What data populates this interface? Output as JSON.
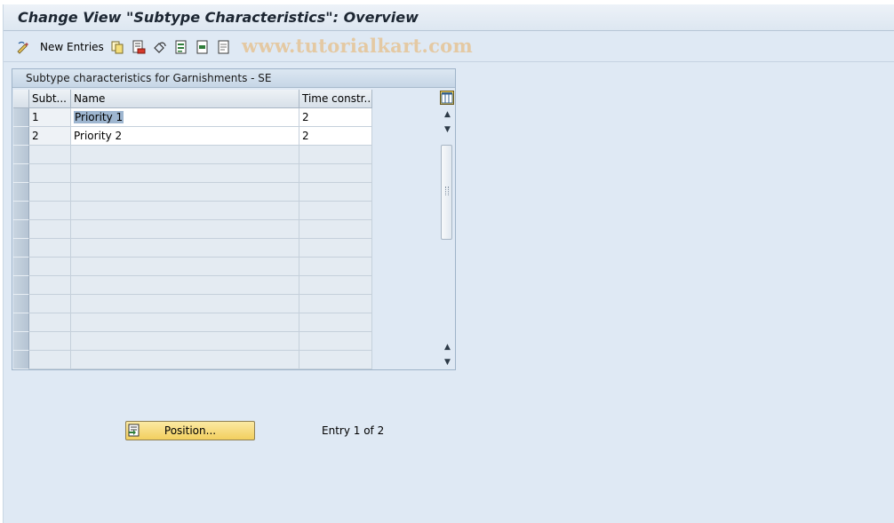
{
  "window": {
    "title": "Change View \"Subtype Characteristics\": Overview"
  },
  "toolbar": {
    "new_entries_label": "New Entries",
    "icons": [
      "change-display-icon",
      "copy-icon",
      "delete-icon",
      "undo-change-icon",
      "select-all-icon",
      "select-block-icon",
      "deselect-all-icon"
    ],
    "watermark": "www.tutorialkart.com"
  },
  "table": {
    "caption": "Subtype characteristics for Garnishments - SE",
    "columns": [
      "Subt...",
      "Name",
      "Time constr..."
    ],
    "rows": [
      {
        "subtype": "1",
        "name": "Priority 1",
        "time_constraint": "2"
      },
      {
        "subtype": "2",
        "name": "Priority 2",
        "time_constraint": "2"
      }
    ],
    "empty_row_count": 12,
    "selected_cell": "Priority 1"
  },
  "footer": {
    "position_button_label": "Position...",
    "entry_info": "Entry 1 of 2"
  },
  "colors": {
    "background": "#dfe9f4",
    "button": "#f5d66f",
    "watermark": "#e4c9a3"
  }
}
